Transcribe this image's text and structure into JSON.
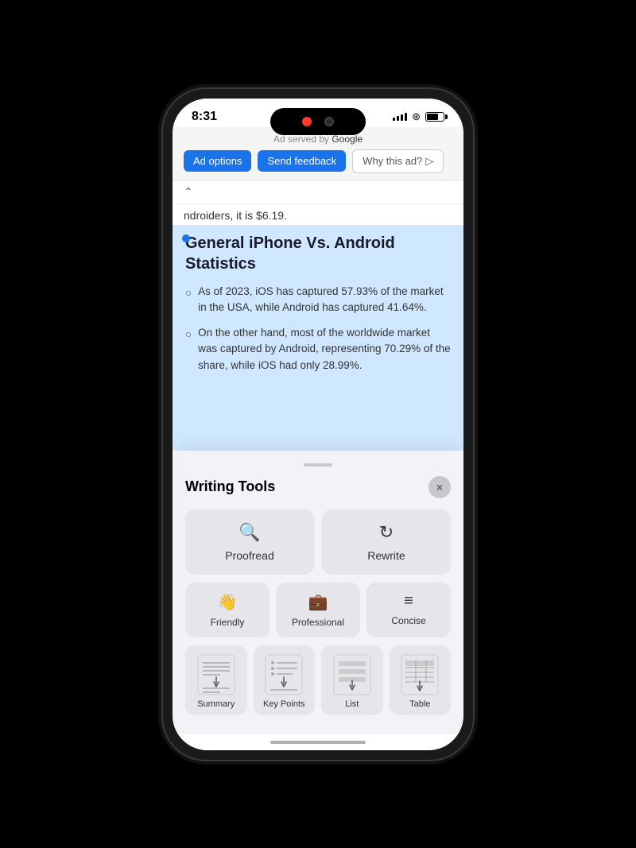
{
  "status": {
    "time": "8:31",
    "battery_pct": 70
  },
  "ad": {
    "served_by": "Ad served by",
    "google_text": "Google",
    "options_label": "Ad options",
    "feedback_label": "Send feedback",
    "why_label": "Why this ad?"
  },
  "article": {
    "breadcrumb_price": "ndroiders, it is $6.19.",
    "title": "General iPhone Vs. Android Statistics",
    "bullet1": "As of 2023, iOS has captured 57.93% of the market in the USA, while Android has captured 41.64%.",
    "bullet2": "On the other hand, most of the worldwide market was captured by Android, representing 70.29% of the share, while iOS had only 28.99%."
  },
  "writing_tools": {
    "title": "Writing Tools",
    "close_label": "×",
    "proofread_label": "Proofread",
    "rewrite_label": "Rewrite",
    "friendly_label": "Friendly",
    "professional_label": "Professional",
    "concise_label": "Concise",
    "summary_label": "Summary",
    "key_points_label": "Key Points",
    "list_label": "List",
    "table_label": "Table"
  }
}
